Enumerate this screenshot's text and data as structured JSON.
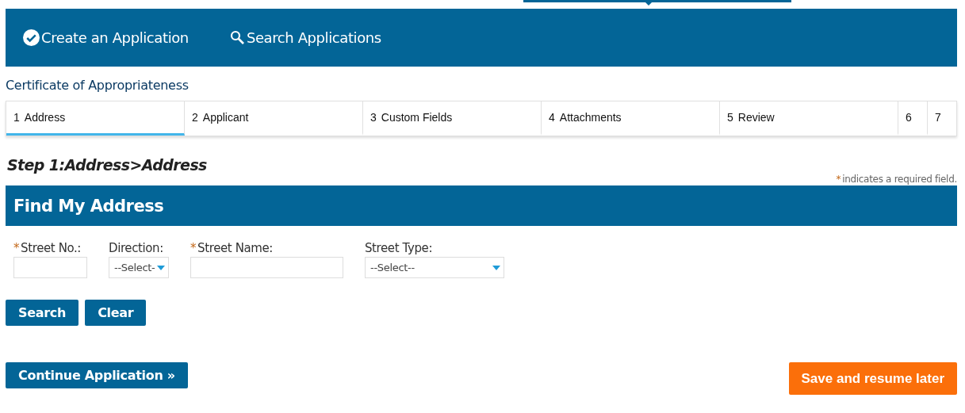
{
  "nav": {
    "items": [
      {
        "label": "Create an Application"
      },
      {
        "label": "Search Applications"
      }
    ]
  },
  "record_type": "Certificate of Appropriateness",
  "steps": [
    {
      "number": "1",
      "label": "Address",
      "selected": true
    },
    {
      "number": "2",
      "label": "Applicant",
      "selected": false
    },
    {
      "number": "3",
      "label": "Custom Fields",
      "selected": false
    },
    {
      "number": "4",
      "label": "Attachments",
      "selected": false
    },
    {
      "number": "5",
      "label": "Review",
      "selected": false
    },
    {
      "number": "6",
      "selected": false
    },
    {
      "number": "7",
      "selected": false
    }
  ],
  "step_heading": "Step 1:Address>Address",
  "required_note": {
    "mark": "*",
    "text": "indicates a required field."
  },
  "section": {
    "title": "Find My Address",
    "fields": [
      {
        "label": "Street No.:",
        "required_mark": "*",
        "kind": "text"
      },
      {
        "label": "Direction:",
        "kind": "select",
        "value": "--Select-"
      },
      {
        "label": "Street Name:",
        "required_mark": "*",
        "kind": "text"
      },
      {
        "label": "Street Type:",
        "kind": "select",
        "value": "--Select--"
      }
    ],
    "buttons": [
      "Search",
      "Clear"
    ]
  },
  "footer": {
    "continue": "Continue Application »",
    "save": "Save and resume later"
  }
}
